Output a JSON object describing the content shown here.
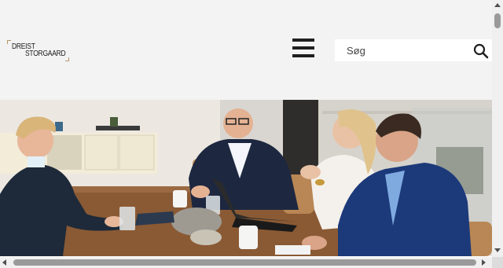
{
  "header": {
    "logo": {
      "line1": "DREIST",
      "line2": "STORGAARD"
    },
    "search": {
      "placeholder": "Søg"
    }
  },
  "hero": {},
  "colors": {
    "header_bg": "#f3f3f3",
    "logo_accent": "#b8946a",
    "icon_dark": "#1f1f1f"
  }
}
